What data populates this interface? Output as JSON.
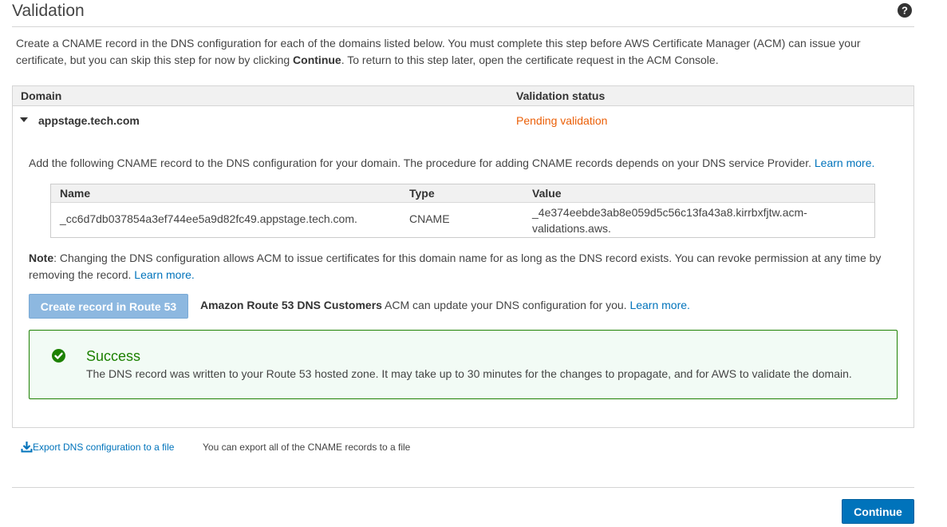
{
  "page": {
    "title": "Validation",
    "help_icon": "help-circle-icon"
  },
  "intro": {
    "text_before": "Create a CNAME record in the DNS configuration for each of the domains listed below. You must complete this step before AWS Certificate Manager (ACM) can issue your certificate, but you can skip this step for now by clicking ",
    "bold": "Continue",
    "text_after": ". To return to this step later, open the certificate request in the ACM Console."
  },
  "domains_table": {
    "columns": {
      "domain": "Domain",
      "status": "Validation status"
    },
    "rows": [
      {
        "domain": "appstage.tech.com",
        "status": "Pending validation",
        "expanded": true
      }
    ]
  },
  "detail": {
    "add_text": "Add the following CNAME record to the DNS configuration for your domain. The procedure for adding CNAME records depends on your DNS service Provider.",
    "learn_more": "Learn more.",
    "cname_table": {
      "columns": {
        "name": "Name",
        "type": "Type",
        "value": "Value"
      },
      "row": {
        "name": "_cc6d7db037854a3ef744ee5a9d82fc49.appstage.tech.com.",
        "type": "CNAME",
        "value": "_4e374eebde3ab8e059d5c56c13fa43a8.kirrbxfjtw.acm-validations.aws."
      }
    },
    "note_label": "Note",
    "note_text": ": Changing the DNS configuration allows ACM to issue certificates for this domain name for as long as the DNS record exists. You can revoke permission at any time by removing the record.",
    "note_learn_more": "Learn more.",
    "route53_button": "Create record in Route 53",
    "route53_bold": "Amazon Route 53 DNS Customers",
    "route53_text": " ACM can update your DNS configuration for you.",
    "route53_learn_more": "Learn more."
  },
  "success": {
    "icon": "check-circle-icon",
    "title": "Success",
    "message": "The DNS record was written to your Route 53 hosted zone. It may take up to 30 minutes for the changes to propagate, and for AWS to validate the domain."
  },
  "export": {
    "icon": "download-icon",
    "link": "Export DNS configuration to a file",
    "note": "You can export all of the CNAME records to a file"
  },
  "footer": {
    "continue_label": "Continue"
  },
  "colors": {
    "link": "#0073bb",
    "pending": "#eb5f07",
    "success": "#1d8102",
    "primary_button": "#0073bb"
  }
}
